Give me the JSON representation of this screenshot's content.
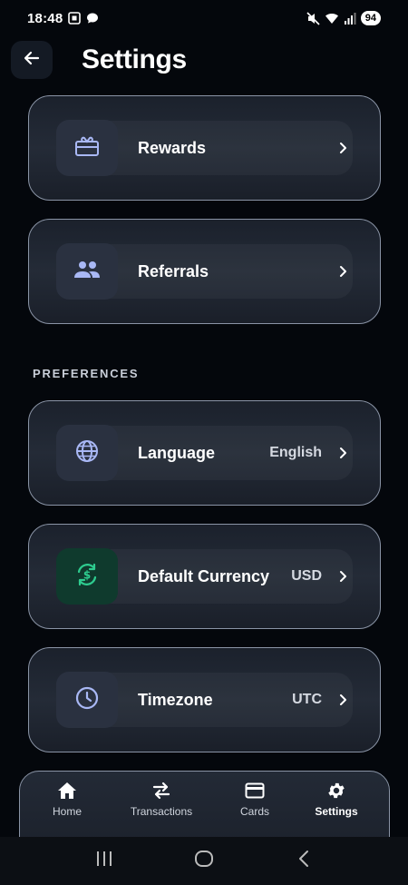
{
  "status_bar": {
    "time": "18:48",
    "battery": "94"
  },
  "header": {
    "title": "Settings"
  },
  "rows_top": [
    {
      "label": "Rewards",
      "icon": "gift-card-icon"
    },
    {
      "label": "Referrals",
      "icon": "people-icon"
    }
  ],
  "preferences": {
    "section_label": "PREFERENCES",
    "rows": [
      {
        "label": "Language",
        "value": "English",
        "icon": "globe-icon"
      },
      {
        "label": "Default Currency",
        "value": "USD",
        "icon": "currency-exchange-icon"
      },
      {
        "label": "Timezone",
        "value": "UTC",
        "icon": "clock-icon"
      }
    ]
  },
  "bottom_nav": {
    "items": [
      {
        "label": "Home",
        "icon": "home-icon"
      },
      {
        "label": "Transactions",
        "icon": "swap-arrows-icon"
      },
      {
        "label": "Cards",
        "icon": "card-icon"
      },
      {
        "label": "Settings",
        "icon": "gear-icon",
        "active": true
      }
    ]
  },
  "colors": {
    "background": "#04070c",
    "accent_icon": "#a9b8f5",
    "currency_icon": "#2ecc8f",
    "card_border": "#8a94a6"
  }
}
